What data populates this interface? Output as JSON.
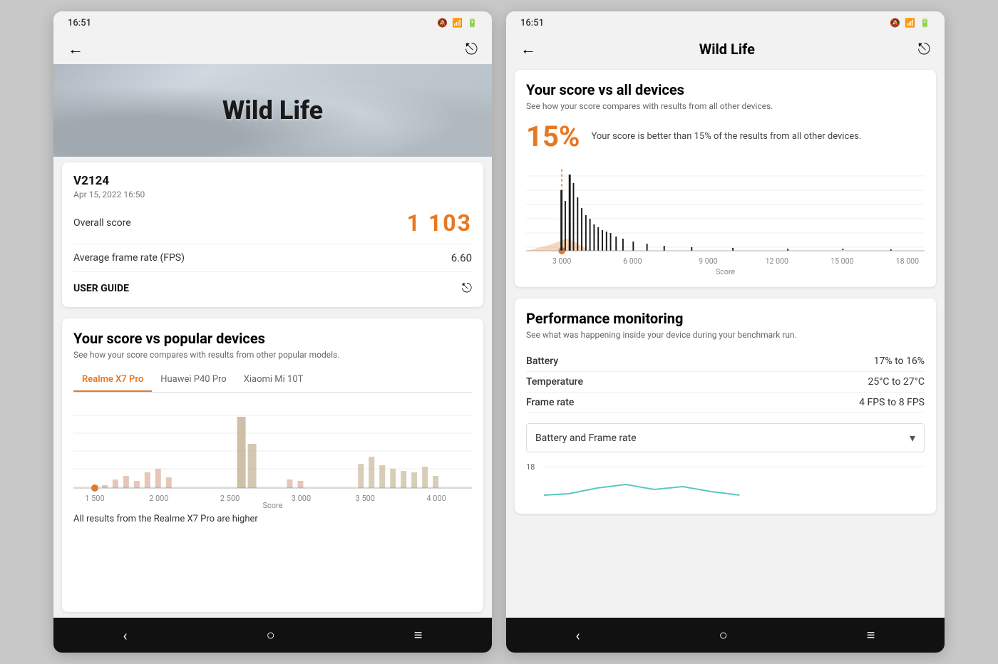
{
  "phone1": {
    "status_time": "16:51",
    "hero_title": "Wild Life",
    "result_code": "V2124",
    "result_date": "Apr 15, 2022 16:50",
    "overall_score_label": "Overall score",
    "overall_score_value": "1 103",
    "fps_label": "Average frame rate (FPS)",
    "fps_value": "6.60",
    "user_guide_label": "USER GUIDE",
    "vs_popular_title": "Your score vs popular devices",
    "vs_popular_desc": "See how your score compares with results from other popular models.",
    "tab1": "Realme X7 Pro",
    "tab2": "Huawei P40 Pro",
    "tab3": "Xiaomi Mi 10T",
    "chart_x_labels": [
      "1 500",
      "2 000",
      "2 500",
      "3 000",
      "3 500",
      "4 000"
    ],
    "score_axis_label": "Score",
    "all_results_text": "All results from the Realme X7 Pro are higher",
    "nav_back": "‹",
    "nav_home": "○",
    "nav_menu": "≡"
  },
  "phone2": {
    "status_time": "16:51",
    "page_title": "Wild Life",
    "vs_all_title": "Your score vs all devices",
    "vs_all_desc": "See how your score compares with results from all other devices.",
    "percentage": "15%",
    "percentage_desc": "Your score is better than 15% of the results from all other devices.",
    "chart_x_labels": [
      "3 000",
      "6 000",
      "9 000",
      "12 000",
      "15 000",
      "18 000"
    ],
    "score_axis_label": "Score",
    "perf_title": "Performance monitoring",
    "perf_desc": "See what was happening inside your device during your benchmark run.",
    "battery_label": "Battery",
    "battery_value": "17% to 16%",
    "temperature_label": "Temperature",
    "temperature_value": "25°C to 27°C",
    "framerate_label": "Frame rate",
    "framerate_value": "4 FPS to 8 FPS",
    "dropdown_label": "Battery and Frame rate",
    "nav_back": "‹",
    "nav_home": "○",
    "nav_menu": "≡"
  }
}
